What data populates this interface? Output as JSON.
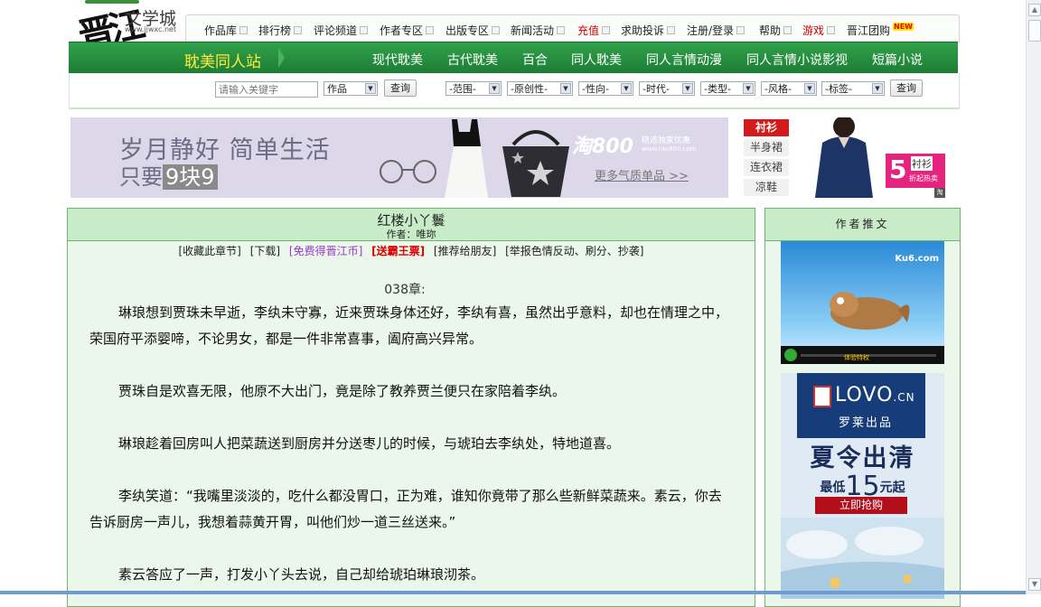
{
  "logo": {
    "brand_cn": "文学城",
    "url": "www.jjwxc.net",
    "mark": "晋江"
  },
  "top_menu": [
    {
      "label": "作品库",
      "dropdown": true,
      "red": false
    },
    {
      "label": "排行榜",
      "dropdown": true,
      "red": false
    },
    {
      "label": "评论频道",
      "dropdown": true,
      "red": false
    },
    {
      "label": "作者专区",
      "dropdown": true,
      "red": false
    },
    {
      "label": "出版专区",
      "dropdown": true,
      "red": false
    },
    {
      "label": "新闻活动",
      "dropdown": true,
      "red": false
    },
    {
      "label": "充值",
      "dropdown": true,
      "red": true
    },
    {
      "label": "求助投诉",
      "dropdown": true,
      "red": false
    },
    {
      "label": "注册/登录",
      "dropdown": true,
      "red": false
    },
    {
      "label": "帮助",
      "dropdown": true,
      "red": false
    },
    {
      "label": "游戏",
      "dropdown": true,
      "red": true
    },
    {
      "label": "晋江团购",
      "dropdown": false,
      "red": false,
      "badge": "NEW"
    }
  ],
  "channel_bar": {
    "site_name": "耽美同人站",
    "channels": [
      "现代耽美",
      "古代耽美",
      "百合",
      "同人耽美",
      "同人言情动漫",
      "同人言情小说影视",
      "短篇小说"
    ]
  },
  "search": {
    "keyword_placeholder": "请输入关键字",
    "type_select": "作品",
    "query_button": "查询",
    "filters": [
      "-范围-",
      "-原创性-",
      "-性向-",
      "-时代-",
      "-类型-",
      "-风格-",
      "-标签-"
    ],
    "filter_query_button": "查询"
  },
  "banner": {
    "line1": "岁月静好 简单生活",
    "line2_prefix": "只要",
    "line2_price": "9块9",
    "brand": "淘800",
    "brand_sub": "精选独家优惠",
    "brand_url": "www.tao800.com",
    "more_link": "更多气质单品 >>"
  },
  "side_ad": {
    "tags": [
      "衬衫",
      "半身裙",
      "连衣裙",
      "凉鞋"
    ],
    "promo_number": "5",
    "promo_title": "衬衫",
    "promo_sub": "折起热卖",
    "taobao": "淘"
  },
  "article": {
    "title": "红楼小丫鬟",
    "author_line": "作者：唯珎",
    "actions": [
      {
        "label": "[收藏此章节]",
        "style": "normal"
      },
      {
        "label": "[下载]",
        "style": "normal"
      },
      {
        "label": "[免费得晋江币]",
        "style": "purple"
      },
      {
        "label": "[送霸王票]",
        "style": "red"
      },
      {
        "label": "[推荐给朋友]",
        "style": "normal"
      },
      {
        "label": "[举报色情反动、刷分、抄袭]",
        "style": "normal"
      }
    ],
    "chapter": "038章:",
    "paragraphs": [
      "琳琅想到贾珠未早逝，李纨未守寡，近来贾珠身体还好，李纨有喜，虽然出乎意料，却也在情理之中，荣国府平添婴啼，不论男女，都是一件非常喜事，阖府高兴异常。",
      "贾珠自是欢喜无限，他原不大出门，竟是除了教养贾兰便只在家陪着李纨。",
      "琳琅趁着回房叫人把菜蔬送到厨房并分送枣儿的时候，与琥珀去李纨处，特地道喜。",
      "李纨笑道：“我嘴里淡淡的，吃什么都没胃口，正为难，谁知你竟带了那么些新鲜菜蔬来。素云，你去告诉厨房一声儿，我想着蒜黄开胃，叫他们炒一道三丝送来。”",
      "素云答应了一声，打发小丫头去说，自己却给琥珀琳琅沏茶。"
    ]
  },
  "right_panel": {
    "header": "作者推文",
    "video": {
      "logo": "Ku6.com",
      "label": "体验特权"
    },
    "lovo": {
      "brand": "LOVO",
      "brand_suffix": ".CN",
      "sub": "罗莱出品",
      "headline": "夏令出清",
      "price_prefix": "最低",
      "price": "15",
      "price_suffix": "元起",
      "button": "立即抢购"
    }
  }
}
